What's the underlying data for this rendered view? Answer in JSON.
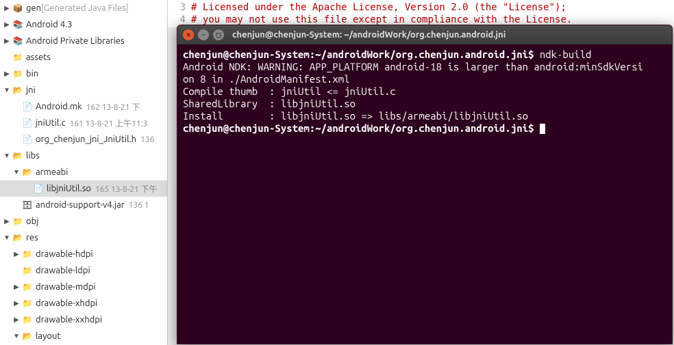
{
  "tree": {
    "gen": {
      "label": "gen",
      "suffix": " [Generated Java Files]"
    },
    "android43": {
      "label": "Android 4.3"
    },
    "androidPrivLibs": {
      "label": "Android Private Libraries"
    },
    "assets": {
      "label": "assets"
    },
    "bin": {
      "label": "bin"
    },
    "jni": {
      "label": "jni"
    },
    "androidMk": {
      "label": "Android.mk",
      "meta": "162  13-8-21 下"
    },
    "jniUtilC": {
      "label": "jniUtil.c",
      "meta": "161  13-8-21 上午11:3"
    },
    "jniUtilH": {
      "label": "org_chenjun_jni_JniUtil.h",
      "meta": "136"
    },
    "libs": {
      "label": "libs"
    },
    "armeabi": {
      "label": "armeabi"
    },
    "libjniUtilSo": {
      "label": "libjniUtil.so",
      "meta": "165  13-8-21 下午"
    },
    "supportJar": {
      "label": "android-support-v4.jar",
      "meta": "136  1"
    },
    "obj": {
      "label": "obj"
    },
    "res": {
      "label": "res"
    },
    "drawableHdpi": {
      "label": "drawable-hdpi"
    },
    "drawableLdpi": {
      "label": "drawable-ldpi"
    },
    "drawableMdpi": {
      "label": "drawable-mdpi"
    },
    "drawableXhdpi": {
      "label": "drawable-xhdpi"
    },
    "drawableXxhdpi": {
      "label": "drawable-xxhdpi"
    },
    "layout": {
      "label": "layout"
    }
  },
  "editor": {
    "line3num": "3",
    "line3": "# Licensed under the Apache License, Version 2.0 (the \"License\");",
    "line4num": "4",
    "line4": "# you may not use this file except in compliance with the License."
  },
  "terminal": {
    "title": "chenjun@chenjun-System: ~/androidWork/org.chenjun.android.jni",
    "prompt1": "chenjun@chenjun-System:~/androidWork/org.chenjun.android.jni$ ",
    "cmd1": "ndk-build",
    "out1": "Android NDK: WARNING: APP_PLATFORM android-18 is larger than android:minSdkVersi",
    "out2": "on 8 in ./AndroidManifest.xml    ",
    "out3": "Compile thumb  : jniUtil <= jniUtil.c",
    "out4": "SharedLibrary  : libjniUtil.so",
    "out5": "Install        : libjniUtil.so => libs/armeabi/libjniUtil.so",
    "prompt2": "chenjun@chenjun-System:~/androidWork/org.chenjun.android.jni$ "
  }
}
